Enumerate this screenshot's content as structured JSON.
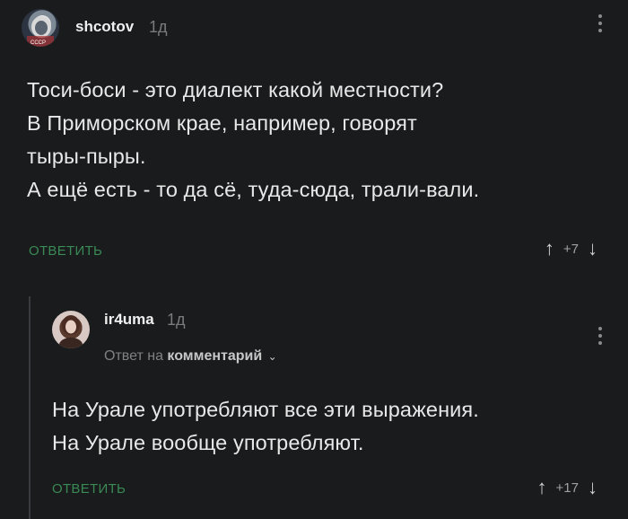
{
  "comment1": {
    "author": "shcotov",
    "time": "1д",
    "lines": [
      "Тоси-боси - это диалект какой местности?",
      "В Приморском крае, например, говорят",
      "тыры-пыры.",
      "А ещё есть - то да сё, туда-сюда, трали-вали."
    ],
    "reply_label": "ОТВЕТИТЬ",
    "score": "+7",
    "up_icon": "↑",
    "down_icon": "↓"
  },
  "comment2": {
    "author": "ir4uma",
    "time": "1д",
    "reply_prefix": "Ответ на",
    "reply_target": "комментарий",
    "chevron": "⌄",
    "lines": [
      "На Урале употребляют все эти выражения.",
      "На Урале вообще употребляют."
    ],
    "reply_label": "ОТВЕТИТЬ",
    "score": "+17",
    "up_icon": "↑",
    "down_icon": "↓"
  },
  "colors": {
    "background": "#1a1b1d",
    "accent_green": "#3a8a55",
    "text": "#e8e8e8",
    "muted": "#7a7b7d"
  }
}
